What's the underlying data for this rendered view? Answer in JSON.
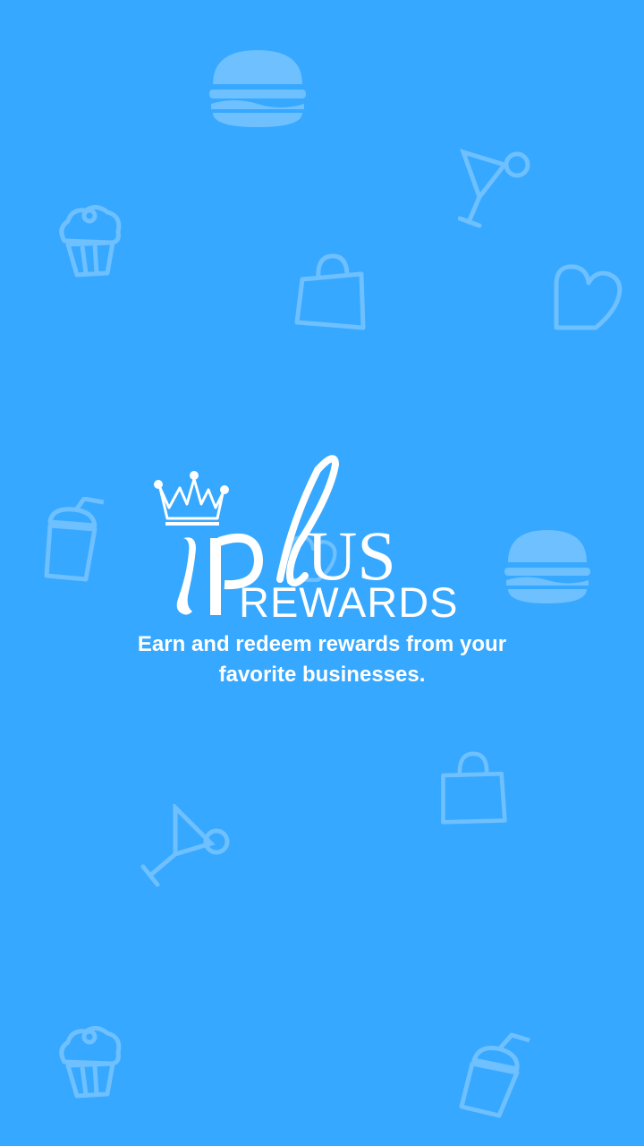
{
  "app": {
    "logo_text": {
      "word_top": "plus",
      "word_bottom": "REWARDS",
      "prefix_letter": "i"
    }
  },
  "tagline": {
    "line1": "Earn and redeem rewards from your",
    "line2": "favorite businesses."
  },
  "colors": {
    "background": "#36a8ff",
    "foreground": "#ffffff"
  },
  "background_icons": [
    "burger-icon",
    "martini-icon",
    "cupcake-icon",
    "shopping-bag-icon",
    "heart-icon",
    "drink-cup-icon"
  ]
}
